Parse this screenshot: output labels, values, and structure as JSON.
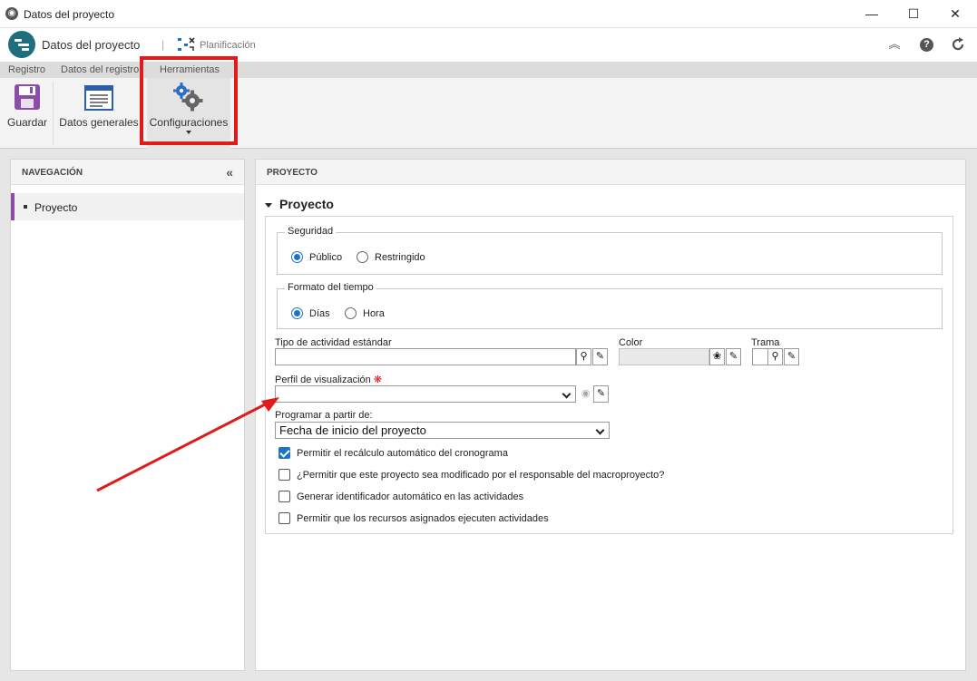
{
  "window": {
    "title": "Datos del proyecto",
    "minimize": "—",
    "maximize": "☐",
    "close": "✕"
  },
  "header": {
    "app_title": "Datos del proyecto",
    "separator": "|",
    "planning_label": "Planificación"
  },
  "tabs": [
    "Registro",
    "Datos del registro",
    "Herramientas"
  ],
  "ribbon": {
    "save": "Guardar",
    "general": "Datos generales",
    "settings": "Configuraciones"
  },
  "nav": {
    "title": "NAVEGACIÓN",
    "collapse": "«",
    "item": "Proyecto"
  },
  "main": {
    "title": "PROYECTO",
    "section": "Proyecto",
    "security": {
      "legend": "Seguridad",
      "options": [
        "Público",
        "Restringido"
      ],
      "selected": 0
    },
    "time_format": {
      "legend": "Formato del tiempo",
      "options": [
        "Días",
        "Hora"
      ],
      "selected": 0
    },
    "activity_type_label": "Tipo de actividad estándar",
    "color_label": "Color",
    "pattern_label": "Trama",
    "profile_label": "Perfil de visualización",
    "schedule_label": "Programar a partir de:",
    "schedule_value": "Fecha de inicio del proyecto",
    "checkboxes": [
      {
        "label": "Permitir el recálculo automático del cronograma",
        "checked": true
      },
      {
        "label": "¿Permitir que este proyecto sea modificado por el responsable del macroproyecto?",
        "checked": false
      },
      {
        "label": "Generar identificador automático en las actividades",
        "checked": false
      },
      {
        "label": "Permitir que los recursos asignados ejecuten actividades",
        "checked": false
      }
    ]
  },
  "colors": {
    "highlight": "#e01b1b",
    "accent": "#1a73c8",
    "nav_accent": "#8a4ea8",
    "logo": "#1f6e7e"
  }
}
